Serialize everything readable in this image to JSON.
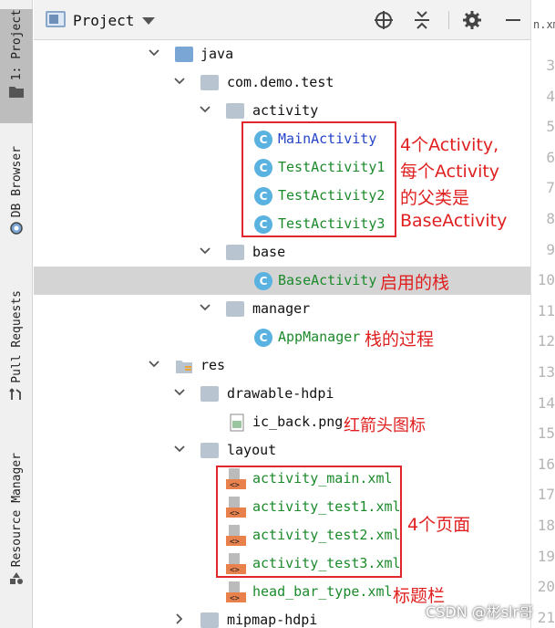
{
  "sidebar": {
    "tabs": [
      {
        "label": "1: Project"
      },
      {
        "label": "DB Browser"
      },
      {
        "label": "Pull Requests"
      },
      {
        "label": "Resource Manager"
      }
    ]
  },
  "header": {
    "title": "Project"
  },
  "editor": {
    "tab_fragment": "n.xm",
    "line_numbers": [
      "3",
      "4",
      "5",
      "6",
      "7",
      "8",
      "9",
      "10",
      "11",
      "12",
      "13",
      "14",
      "15",
      "16",
      "17",
      "18",
      "19",
      "20",
      "21"
    ]
  },
  "tree": {
    "java": "java",
    "package": "com.demo.test",
    "activity_folder": "activity",
    "activities": [
      "MainActivity",
      "TestActivity1",
      "TestActivity2",
      "TestActivity3"
    ],
    "base_folder": "base",
    "base_activity": "BaseActivity",
    "manager_folder": "manager",
    "app_manager": "AppManager",
    "res": "res",
    "drawable": "drawable-hdpi",
    "ic_back": "ic_back.png",
    "layout": "layout",
    "layouts": [
      "activity_main.xml",
      "activity_test1.xml",
      "activity_test2.xml",
      "activity_test3.xml"
    ],
    "head_bar": "head_bar_type.xml",
    "mipmap": "mipmap-hdpi"
  },
  "annotations": {
    "activities_1": "4个Activity,",
    "activities_2": "每个Activity",
    "activities_3": "的父类是",
    "activities_4": "BaseActivity",
    "base": "启用的栈",
    "manager": "栈的过程",
    "ic_back": "红箭头图标",
    "layouts": "4个页面",
    "head_bar": "标题栏"
  },
  "watermark": "CSDN @彬slr哥",
  "colors": {
    "annotation_red": "#e02020",
    "class_green": "#1b8a2b",
    "class_blue": "#2544c8",
    "selection": "#d4d4d4"
  }
}
